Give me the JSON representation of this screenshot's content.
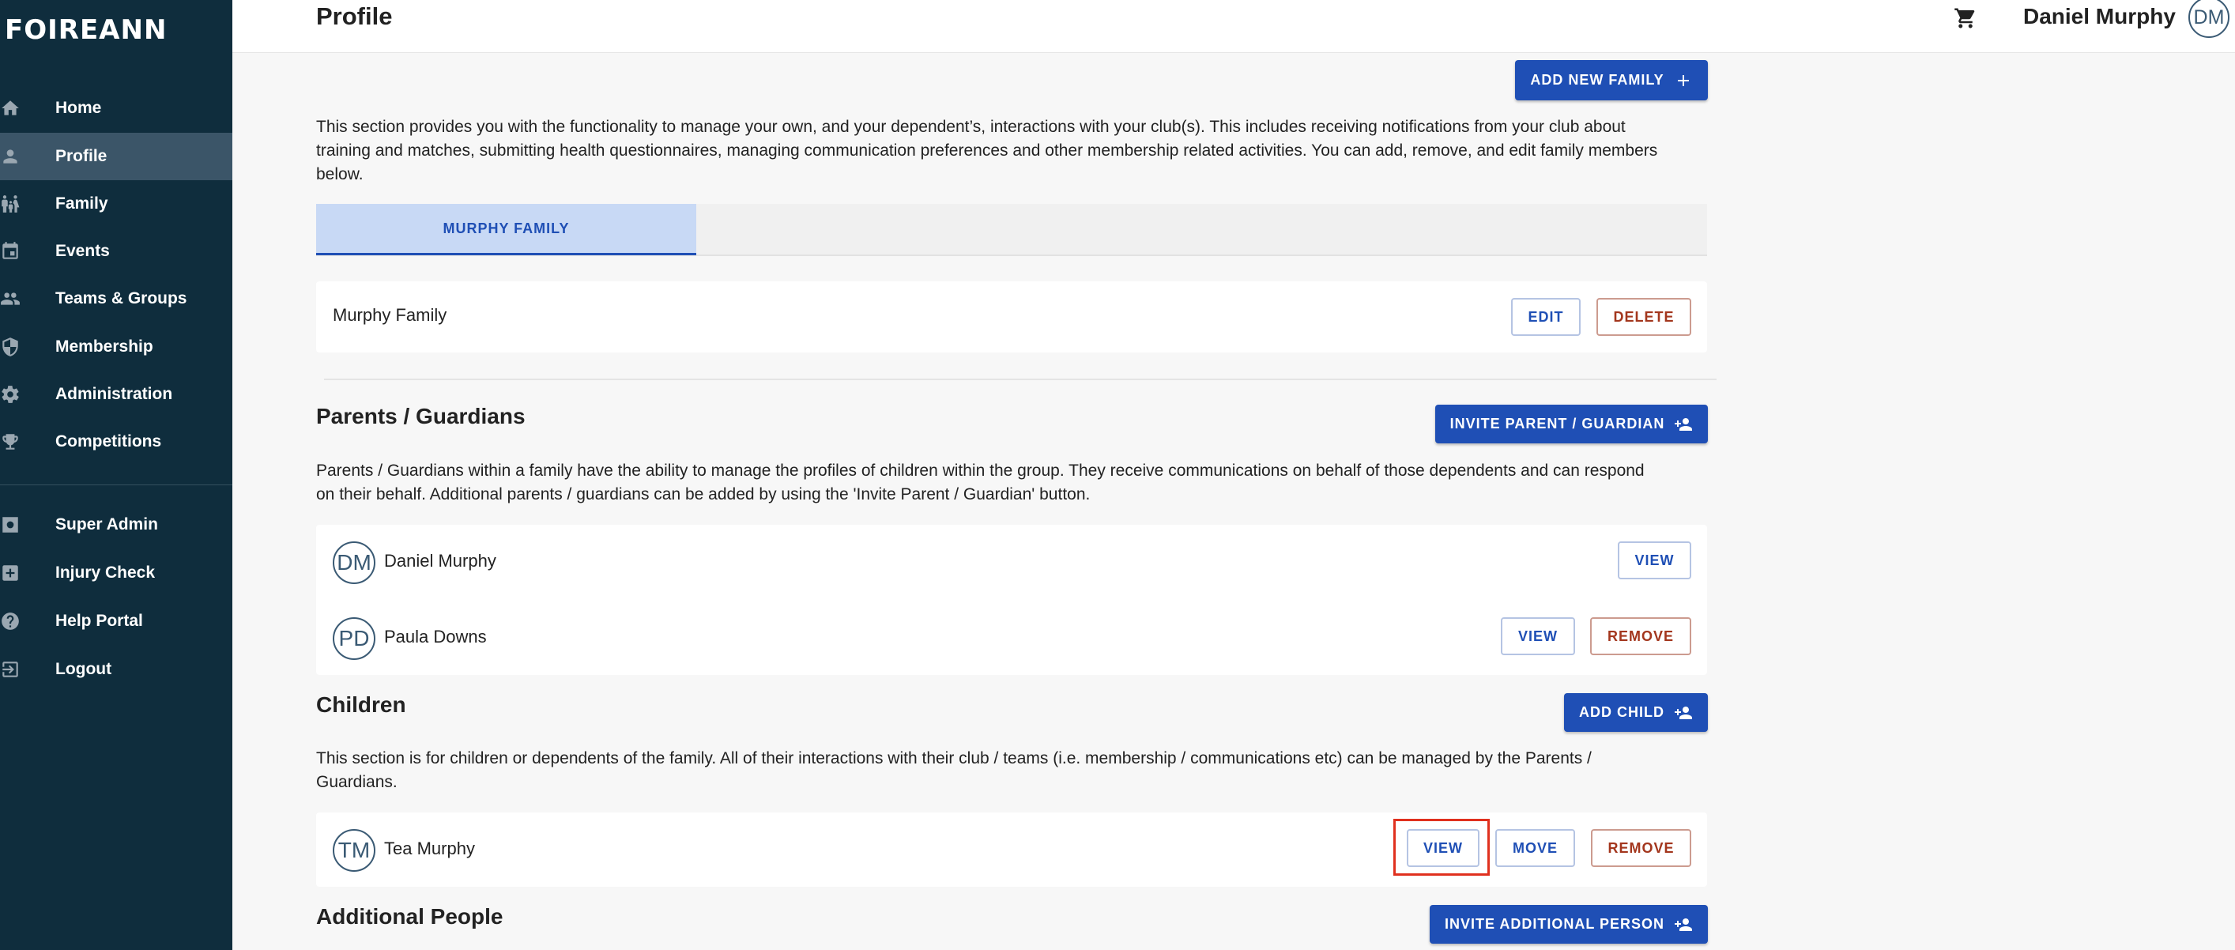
{
  "app": {
    "logo": "FOIREANN"
  },
  "sidebar": {
    "items": [
      {
        "label": "Home",
        "icon": "home-icon"
      },
      {
        "label": "Profile",
        "icon": "person-icon",
        "active": true
      },
      {
        "label": "Family",
        "icon": "family-icon"
      },
      {
        "label": "Events",
        "icon": "calendar-icon"
      },
      {
        "label": "Teams & Groups",
        "icon": "group-icon"
      },
      {
        "label": "Membership",
        "icon": "shield-icon"
      },
      {
        "label": "Administration",
        "icon": "gear-icon"
      },
      {
        "label": "Competitions",
        "icon": "trophy-icon"
      }
    ],
    "secondary": [
      {
        "label": "Super Admin",
        "icon": "admin-gear-icon"
      },
      {
        "label": "Injury Check",
        "icon": "medical-plus-icon"
      },
      {
        "label": "Help Portal",
        "icon": "help-icon"
      },
      {
        "label": "Logout",
        "icon": "logout-icon"
      }
    ]
  },
  "header": {
    "title": "Profile",
    "user_name": "Daniel Murphy",
    "user_initials": "DM"
  },
  "main": {
    "add_family_label": "ADD NEW FAMILY",
    "intro": "This section provides you with the functionality to manage your own, and your dependent’s, interactions with your club(s). This includes receiving notifications from your club about training and matches, submitting health questionnaires, managing communication preferences and other membership related activities. You can add, remove, and edit family members below.",
    "tabs": [
      {
        "label": "MURPHY FAMILY",
        "active": true
      }
    ],
    "family": {
      "name": "Murphy Family",
      "edit_label": "EDIT",
      "delete_label": "DELETE"
    },
    "parents": {
      "title": "Parents / Guardians",
      "invite_label": "INVITE PARENT / GUARDIAN",
      "description": "Parents / Guardians within a family have the ability to manage the profiles of children within the group. They receive communications on behalf of those dependents and can respond on their behalf. Additional parents / guardians can be added by using the 'Invite Parent / Guardian' button.",
      "members": [
        {
          "initials": "DM",
          "name": "Daniel Murphy",
          "view_label": "VIEW"
        },
        {
          "initials": "PD",
          "name": "Paula Downs",
          "view_label": "VIEW",
          "remove_label": "REMOVE"
        }
      ]
    },
    "children": {
      "title": "Children",
      "add_label": "ADD CHILD",
      "description": "This section is for children or dependents of the family. All of their interactions with their club / teams (i.e. membership / communications etc) can be managed by the Parents / Guardians.",
      "members": [
        {
          "initials": "TM",
          "name": "Tea Murphy",
          "view_label": "VIEW",
          "move_label": "MOVE",
          "remove_label": "REMOVE"
        }
      ]
    },
    "additional": {
      "title": "Additional People",
      "invite_label": "INVITE ADDITIONAL PERSON"
    }
  },
  "colors": {
    "sidebar_bg": "#0f2d3d",
    "sidebar_active": "#3b5568",
    "primary": "#1f4fb5",
    "danger": "#a3361d",
    "highlight": "#e0301e"
  }
}
